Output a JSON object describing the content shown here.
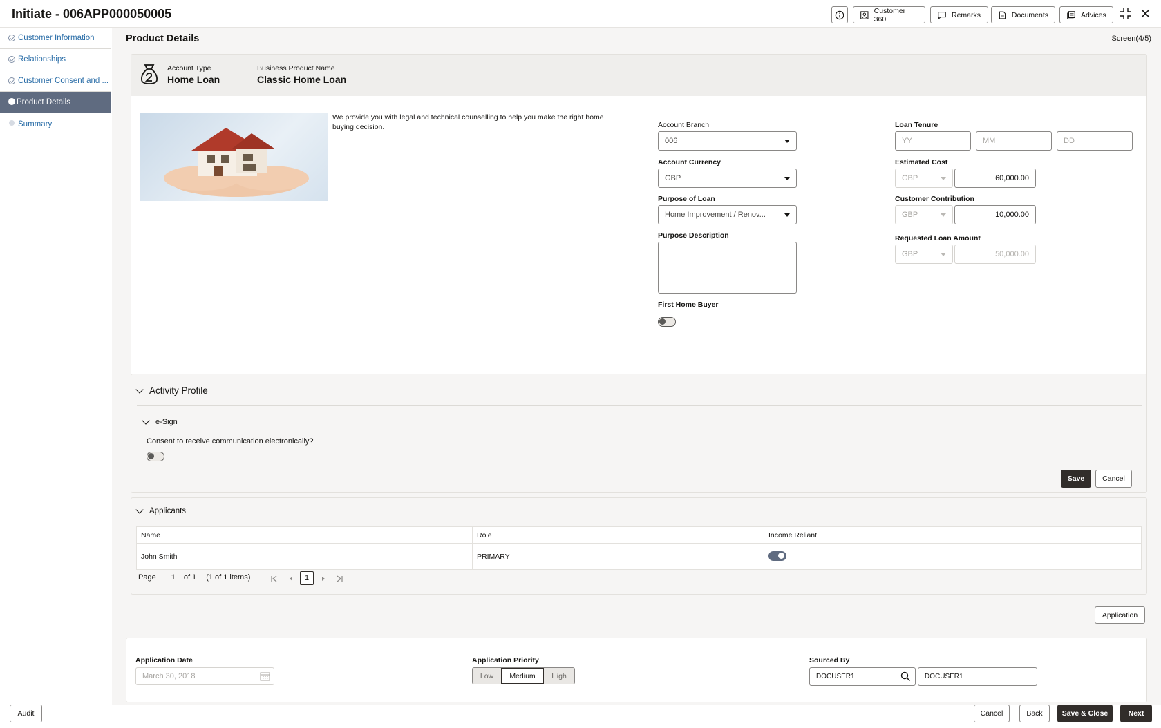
{
  "header": {
    "title": "Initiate - 006APP000050005",
    "buttons": {
      "customer360": "Customer 360",
      "remarks": "Remarks",
      "documents": "Documents",
      "advices": "Advices"
    }
  },
  "sidebar": {
    "steps": [
      {
        "label": "Customer Information"
      },
      {
        "label": "Relationships"
      },
      {
        "label": "Customer Consent and ..."
      },
      {
        "label": "Product Details"
      },
      {
        "label": "Summary"
      }
    ]
  },
  "main": {
    "title": "Product Details",
    "screen": "Screen(4/5)",
    "product": {
      "account_type_label": "Account Type",
      "account_type": "Home Loan",
      "business_product_label": "Business Product Name",
      "business_product": "Classic Home Loan",
      "description": "We provide you with legal and technical counselling to help you make the right home buying decision."
    },
    "form": {
      "account_branch_label": "Account Branch",
      "account_branch": "006",
      "account_currency_label": "Account Currency",
      "account_currency": "GBP",
      "purpose_label": "Purpose of Loan",
      "purpose": "Home Improvement / Renov...",
      "purpose_desc_label": "Purpose Description",
      "first_home_label": "First Home Buyer",
      "first_home_buyer": false,
      "loan_tenure_label": "Loan Tenure",
      "tenure_yy": "YY",
      "tenure_mm": "MM",
      "tenure_dd": "DD",
      "estimated_cost_label": "Estimated Cost",
      "estimated_cost_ccy": "GBP",
      "estimated_cost": "60,000.00",
      "contribution_label": "Customer Contribution",
      "contribution_ccy": "GBP",
      "contribution": "10,000.00",
      "requested_label": "Requested Loan Amount",
      "requested_ccy": "GBP",
      "requested": "50,000.00"
    },
    "activity": {
      "title": "Activity Profile",
      "esign_title": "e-Sign",
      "consent_question": "Consent to receive communication electronically?",
      "consent": false,
      "save": "Save",
      "cancel": "Cancel"
    },
    "applicants": {
      "title": "Applicants",
      "columns": [
        "Name",
        "Role",
        "Income Reliant"
      ],
      "rows": [
        {
          "name": "John Smith",
          "role": "PRIMARY",
          "income_reliant": true
        }
      ],
      "pager": {
        "page_label": "Page",
        "page": "1",
        "of": "of 1",
        "items": "(1 of 1 items)",
        "current": "1"
      }
    },
    "application_button": "Application",
    "footer": {
      "app_date_label": "Application Date",
      "app_date": "March 30, 2018",
      "priority_label": "Application Priority",
      "priority_options": [
        "Low",
        "Medium",
        "High"
      ],
      "priority_selected": "Medium",
      "sourced_by_label": "Sourced By",
      "sourced_by_1": "DOCUSER1",
      "sourced_by_2": "DOCUSER1"
    }
  },
  "bottom_bar": {
    "audit": "Audit",
    "cancel": "Cancel",
    "back": "Back",
    "save_close": "Save & Close",
    "next": "Next"
  },
  "colors": {
    "accent": "#5f6b80",
    "dark_button": "#312d2a",
    "link": "#2b6ea8"
  }
}
